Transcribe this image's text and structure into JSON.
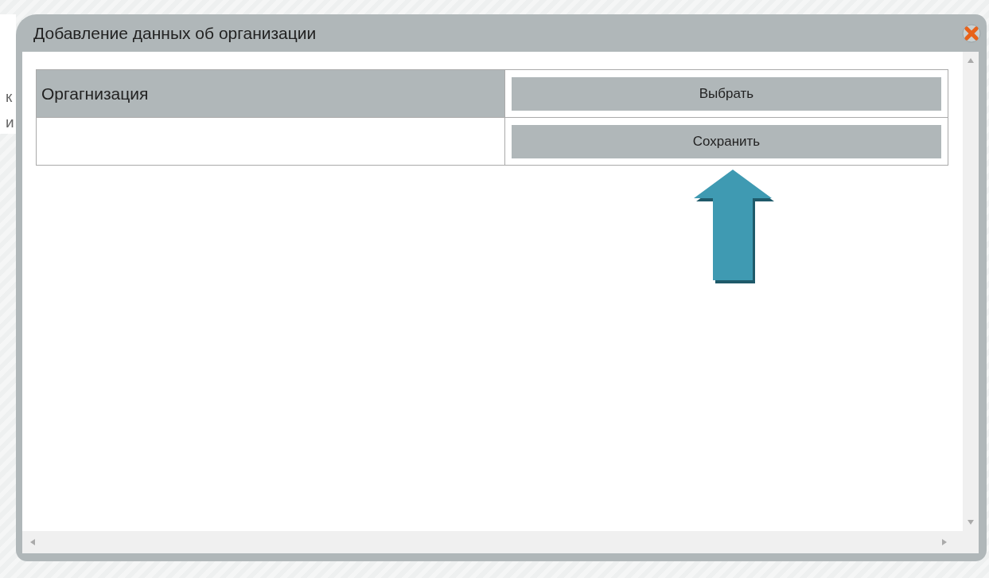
{
  "background_page": {
    "texts": [
      "к",
      "и"
    ]
  },
  "dialog": {
    "title": "Добавление данных об организации",
    "table": {
      "rows": [
        {
          "label": "Оргагнизация",
          "button": "Выбрать"
        },
        {
          "label": "",
          "button": "Сохранить"
        }
      ]
    }
  }
}
